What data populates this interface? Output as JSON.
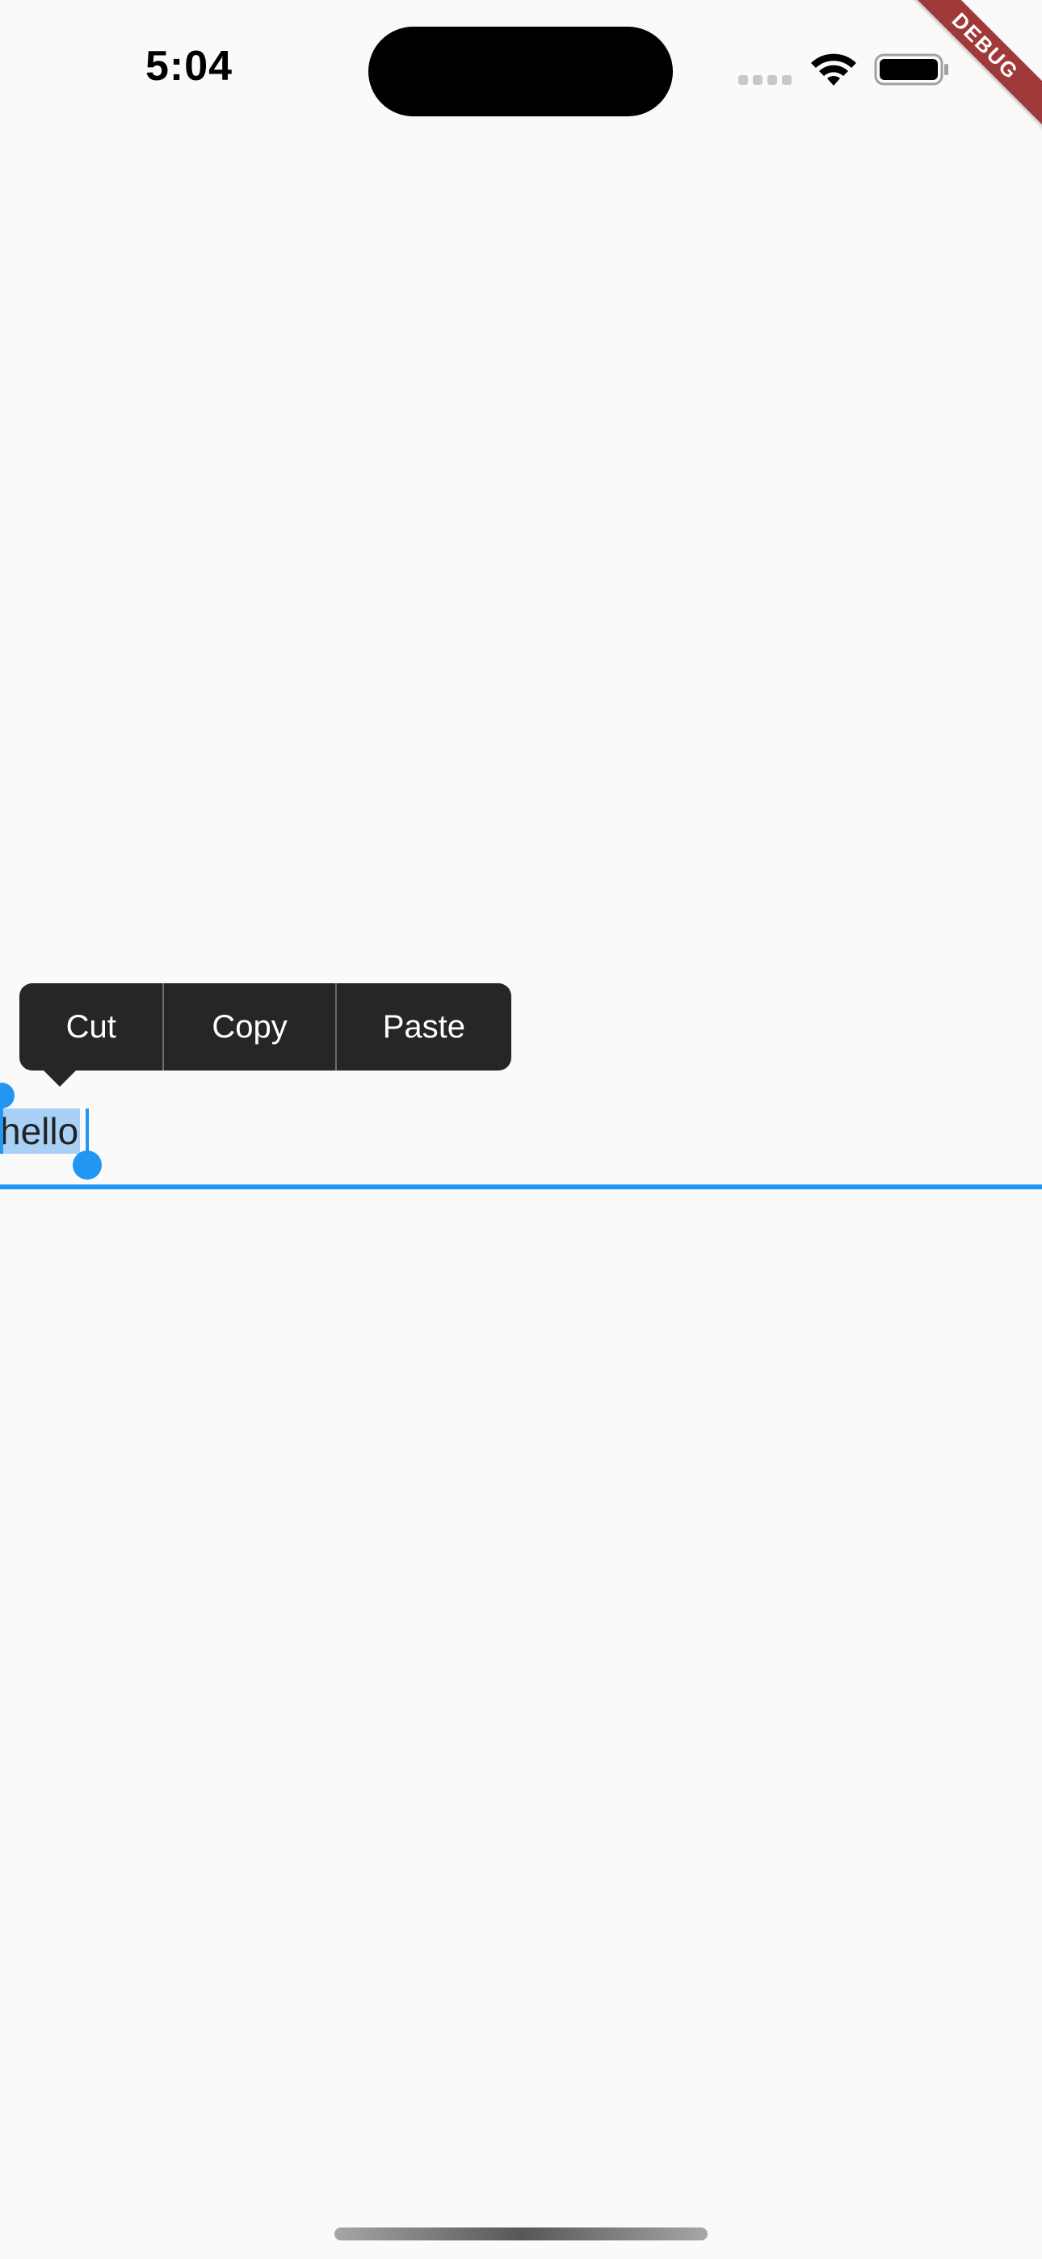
{
  "status_bar": {
    "time": "5:04",
    "icons": [
      "cellular-icon",
      "wifi-icon",
      "battery-icon"
    ]
  },
  "debug_banner": {
    "label": "DEBUG",
    "color": "#a03a3a"
  },
  "context_menu": {
    "items": [
      {
        "label": "Cut"
      },
      {
        "label": "Copy"
      },
      {
        "label": "Paste"
      }
    ],
    "background": "#262626"
  },
  "text_field": {
    "value": "hello",
    "selection_color": "#a8d1f5",
    "accent_color": "#2196f3"
  }
}
